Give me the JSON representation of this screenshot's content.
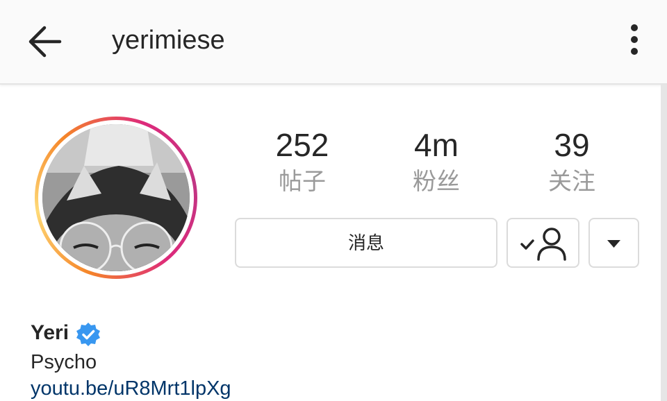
{
  "header": {
    "username": "yerimiese",
    "back_icon": "arrow-left-icon",
    "menu_icon": "vertical-dots-icon"
  },
  "profile": {
    "avatar_ring_colors": [
      "#f58529",
      "#feda77",
      "#dd2a7b",
      "#c13584"
    ],
    "stats": [
      {
        "value": "252",
        "label": "帖子"
      },
      {
        "value": "4m",
        "label": "粉丝"
      },
      {
        "value": "39",
        "label": "关注"
      }
    ],
    "buttons": {
      "message_label": "消息",
      "following_icon": "person-check-icon",
      "dropdown_icon": "caret-down-icon"
    },
    "name": "Yeri",
    "verified_color": "#3897f0",
    "bio": "Psycho",
    "link": "youtu.be/uR8Mrt1lpXg",
    "link_color": "#003569"
  }
}
